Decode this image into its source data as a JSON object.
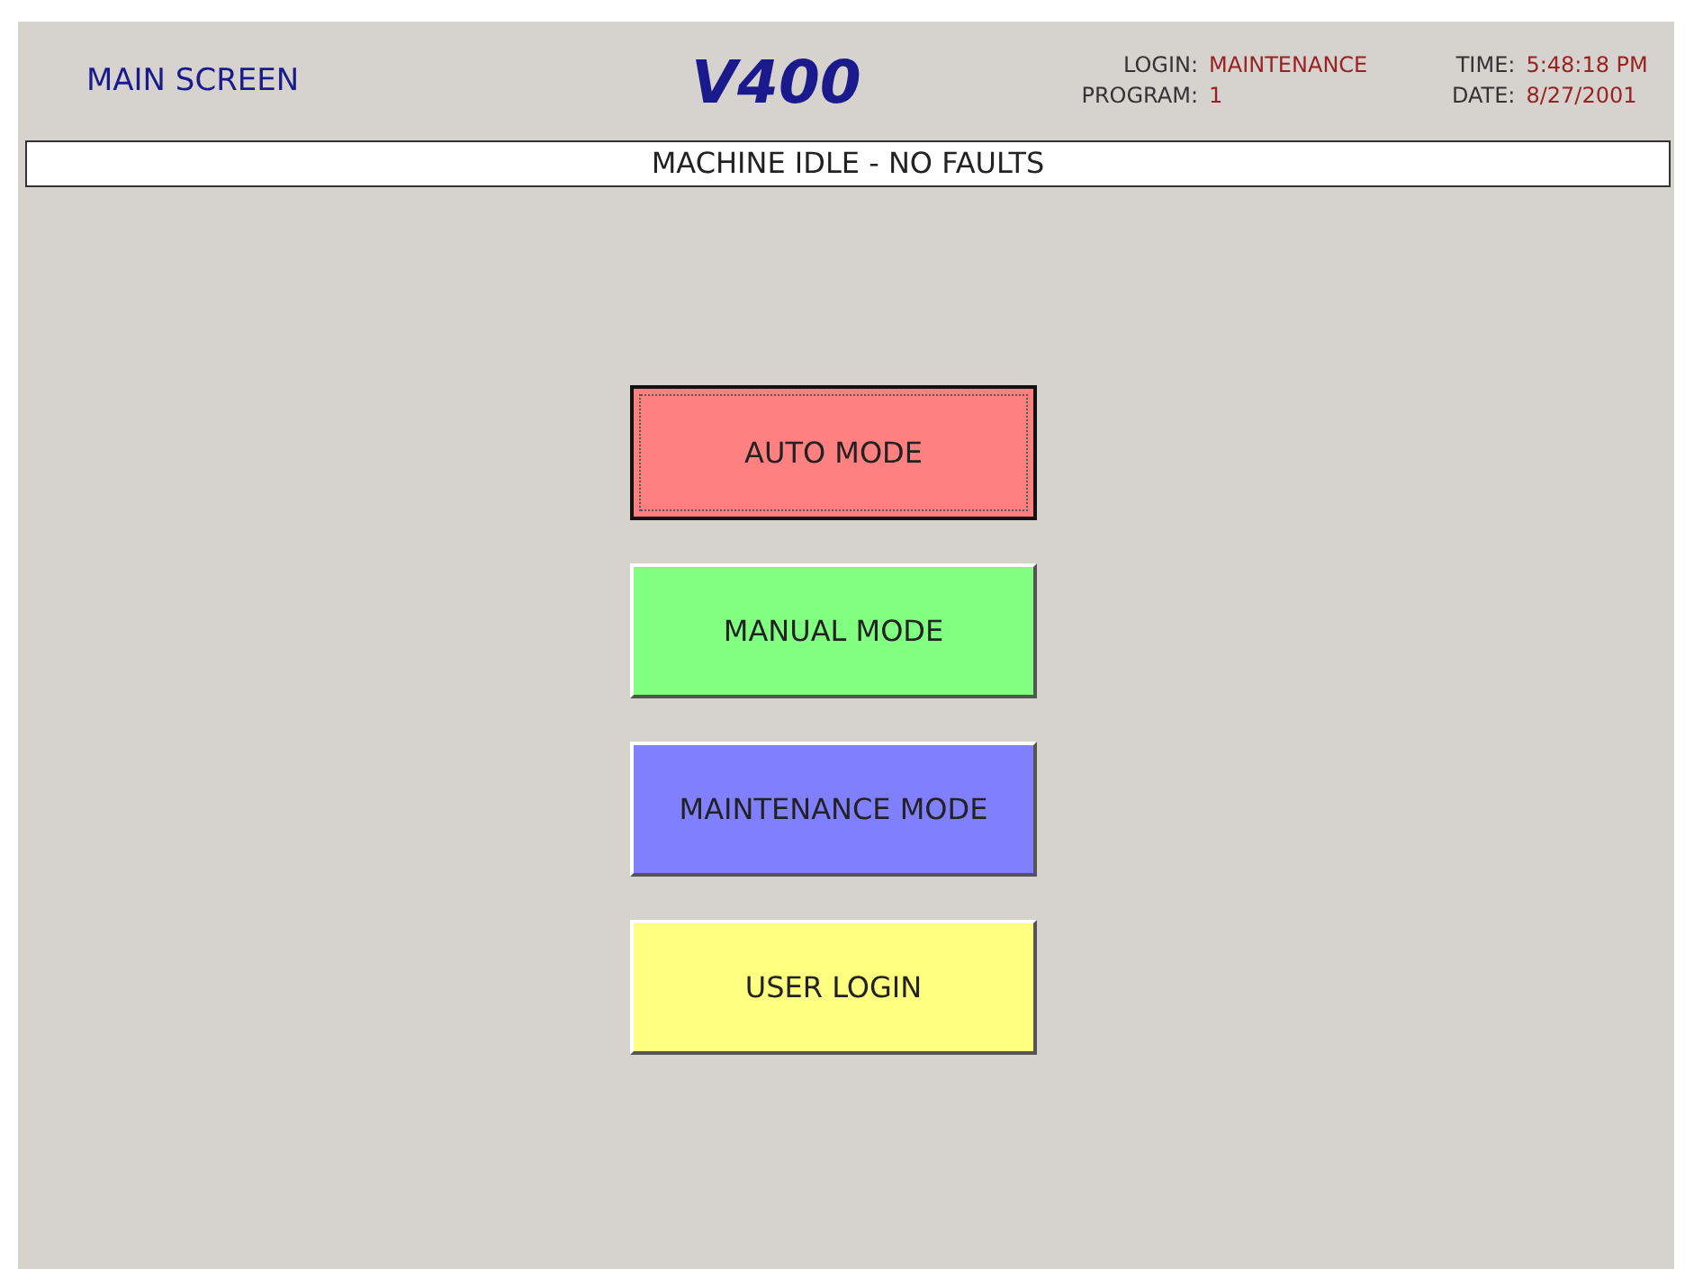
{
  "header": {
    "screen_title": "MAIN SCREEN",
    "logo": "V400",
    "login_label": "LOGIN:",
    "login_value": "MAINTENANCE",
    "program_label": "PROGRAM:",
    "program_value": "1",
    "time_label": "TIME:",
    "time_value": "5:48:18 PM",
    "date_label": "DATE:",
    "date_value": "8/27/2001"
  },
  "status_bar": {
    "message": "MACHINE IDLE - NO FAULTS"
  },
  "buttons": [
    {
      "label": "AUTO MODE",
      "color": "#ff8080",
      "selected": true
    },
    {
      "label": "MANUAL MODE",
      "color": "#80ff80",
      "selected": false
    },
    {
      "label": "MAINTENANCE MODE",
      "color": "#8080ff",
      "selected": false
    },
    {
      "label": "USER LOGIN",
      "color": "#ffff80",
      "selected": false
    }
  ]
}
